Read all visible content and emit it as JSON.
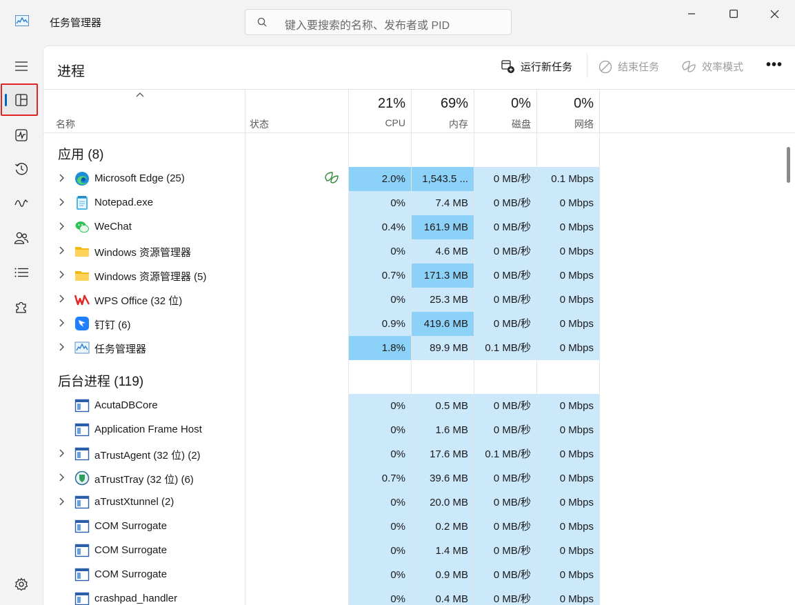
{
  "window": {
    "title": "任务管理器",
    "search_placeholder": "键入要搜索的名称、发布者或 PID"
  },
  "sidebar": {
    "items": [
      "hamburger-menu",
      "processes",
      "performance",
      "app-history",
      "startup-apps",
      "users",
      "details",
      "services",
      "settings"
    ],
    "selected": "processes"
  },
  "toolbar": {
    "page_title": "进程",
    "run_new_task": "运行新任务",
    "end_task": "结束任务",
    "efficiency_mode": "效率模式",
    "more": "•••"
  },
  "columns": {
    "name": "名称",
    "status": "状态",
    "cpu": {
      "pct": "21%",
      "label": "CPU"
    },
    "memory": {
      "pct": "69%",
      "label": "内存"
    },
    "disk": {
      "pct": "0%",
      "label": "磁盘"
    },
    "network": {
      "pct": "0%",
      "label": "网络"
    }
  },
  "groups": {
    "apps": {
      "title": "应用 (8)",
      "rows": [
        {
          "name": "Microsoft Edge (25)",
          "icon": "edge-icon",
          "expandable": true,
          "efficiency": true,
          "cpu": "2.0%",
          "mem": "1,543.5 ...",
          "disk": "0 MB/秒",
          "net": "0.1 Mbps",
          "cpu_hot": true,
          "mem_hot": true
        },
        {
          "name": "Notepad.exe",
          "icon": "notepad-icon",
          "expandable": true,
          "efficiency": false,
          "cpu": "0%",
          "mem": "7.4 MB",
          "disk": "0 MB/秒",
          "net": "0 Mbps",
          "cpu_hot": false,
          "mem_hot": false
        },
        {
          "name": "WeChat",
          "icon": "wechat-icon",
          "expandable": true,
          "efficiency": false,
          "cpu": "0.4%",
          "mem": "161.9 MB",
          "disk": "0 MB/秒",
          "net": "0 Mbps",
          "cpu_hot": false,
          "mem_hot": true
        },
        {
          "name": "Windows 资源管理器",
          "icon": "folder-icon",
          "expandable": true,
          "efficiency": false,
          "cpu": "0%",
          "mem": "4.6 MB",
          "disk": "0 MB/秒",
          "net": "0 Mbps",
          "cpu_hot": false,
          "mem_hot": false
        },
        {
          "name": "Windows 资源管理器 (5)",
          "icon": "folder-icon",
          "expandable": true,
          "efficiency": false,
          "cpu": "0.7%",
          "mem": "171.3 MB",
          "disk": "0 MB/秒",
          "net": "0 Mbps",
          "cpu_hot": false,
          "mem_hot": true
        },
        {
          "name": "WPS Office (32 位)",
          "icon": "wps-icon",
          "expandable": true,
          "efficiency": false,
          "cpu": "0%",
          "mem": "25.3 MB",
          "disk": "0 MB/秒",
          "net": "0 Mbps",
          "cpu_hot": false,
          "mem_hot": false
        },
        {
          "name": "钉钉 (6)",
          "icon": "dingtalk-icon",
          "expandable": true,
          "efficiency": false,
          "cpu": "0.9%",
          "mem": "419.6 MB",
          "disk": "0 MB/秒",
          "net": "0 Mbps",
          "cpu_hot": false,
          "mem_hot": true
        },
        {
          "name": "任务管理器",
          "icon": "taskmgr-icon",
          "expandable": true,
          "efficiency": false,
          "cpu": "1.8%",
          "mem": "89.9 MB",
          "disk": "0.1 MB/秒",
          "net": "0 Mbps",
          "cpu_hot": true,
          "mem_hot": false
        }
      ]
    },
    "background": {
      "title": "后台进程 (119)",
      "rows": [
        {
          "name": "AcutaDBCore",
          "icon": "app-window-icon",
          "expandable": false,
          "cpu": "0%",
          "mem": "0.5 MB",
          "disk": "0 MB/秒",
          "net": "0 Mbps"
        },
        {
          "name": "Application Frame Host",
          "icon": "app-window-icon",
          "expandable": false,
          "cpu": "0%",
          "mem": "1.6 MB",
          "disk": "0 MB/秒",
          "net": "0 Mbps"
        },
        {
          "name": "aTrustAgent (32 位) (2)",
          "icon": "app-window-icon",
          "expandable": true,
          "cpu": "0%",
          "mem": "17.6 MB",
          "disk": "0.1 MB/秒",
          "net": "0 Mbps"
        },
        {
          "name": "aTrustTray (32 位) (6)",
          "icon": "atrust-icon",
          "expandable": true,
          "cpu": "0.7%",
          "mem": "39.6 MB",
          "disk": "0 MB/秒",
          "net": "0 Mbps"
        },
        {
          "name": "aTrustXtunnel (2)",
          "icon": "app-window-icon",
          "expandable": true,
          "cpu": "0%",
          "mem": "20.0 MB",
          "disk": "0 MB/秒",
          "net": "0 Mbps"
        },
        {
          "name": "COM Surrogate",
          "icon": "app-window-icon",
          "expandable": false,
          "cpu": "0%",
          "mem": "0.2 MB",
          "disk": "0 MB/秒",
          "net": "0 Mbps"
        },
        {
          "name": "COM Surrogate",
          "icon": "app-window-icon",
          "expandable": false,
          "cpu": "0%",
          "mem": "1.4 MB",
          "disk": "0 MB/秒",
          "net": "0 Mbps"
        },
        {
          "name": "COM Surrogate",
          "icon": "app-window-icon",
          "expandable": false,
          "cpu": "0%",
          "mem": "0.9 MB",
          "disk": "0 MB/秒",
          "net": "0 Mbps"
        },
        {
          "name": "crashpad_handler",
          "icon": "app-window-icon",
          "expandable": false,
          "cpu": "0%",
          "mem": "0.4 MB",
          "disk": "0 MB/秒",
          "net": "0 Mbps"
        }
      ]
    }
  },
  "colors": {
    "accent": "#0067c0",
    "cell_light": "#cce8fb",
    "cell_hot": "#8cd1f8",
    "selection_outline": "#e02424"
  }
}
